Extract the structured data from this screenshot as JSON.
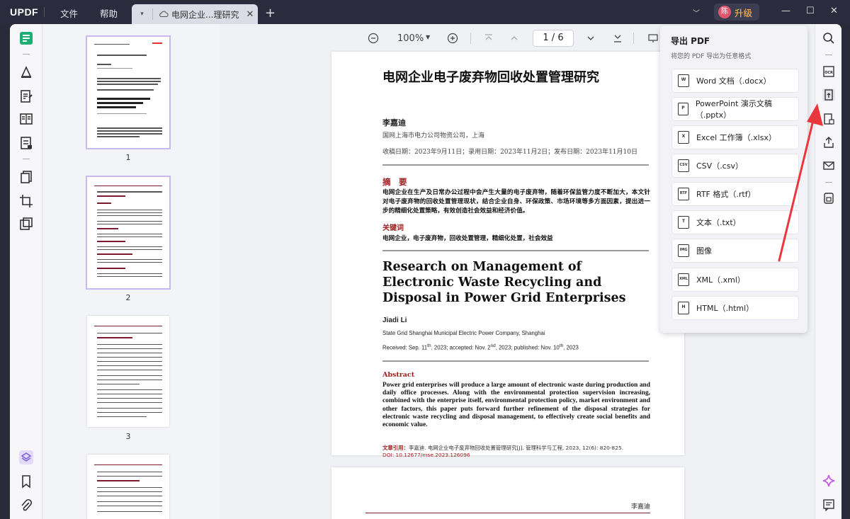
{
  "titlebar": {
    "logo": "UPDF",
    "menu_file": "文件",
    "menu_help": "帮助",
    "tab_title": "电网企业...理研究",
    "tab_close": "✕",
    "new_tab": "+",
    "upgrade_avatar": "陈",
    "upgrade_label": "升级"
  },
  "viewer": {
    "zoom": "100%",
    "page_current": "1",
    "page_total": "6",
    "page_display": "1 / 6"
  },
  "thumbnails": [
    {
      "label": "1"
    },
    {
      "label": "2"
    },
    {
      "label": "3"
    }
  ],
  "document": {
    "title": "电网企业电子废弃物回收处置管理研究",
    "author": "李嘉迪",
    "affiliation": "国网上海市电力公司物资公司，上海",
    "dates": "收稿日期：2023年9月11日；录用日期：2023年11月2日；发布日期：2023年11月10日",
    "abstract_heading": "摘　要",
    "abstract": "电网企业在生产及日常办公过程中会产生大量的电子废弃物，随着环保监管力度不断加大，本文针对电子废弃物的回收处置管理现状，结合企业自身、环保政策、市场环境等多方面因素，提出进一步的精细化处置策略，有效创造社会效益和经济价值。",
    "keywords_heading": "关键词",
    "keywords": "电网企业，电子废弃物，回收处置管理，精细化处置，社会效益",
    "en_title": "Research on Management of Electronic Waste Recycling and Disposal in Power Grid Enterprises",
    "en_author": "Jiadi Li",
    "en_affiliation": "State Grid Shanghai Municipal Electric Power Company, Shanghai",
    "en_dates_a": "Received: Sep. 11",
    "en_dates_b": ", 2023; accepted: Nov. 2",
    "en_dates_c": ", 2023; published: Nov. 10",
    "en_dates_d": ", 2023",
    "sup_th": "th",
    "sup_nd": "nd",
    "en_abstract_heading": "Abstract",
    "en_abstract": "Power grid enterprises will produce a large amount of electronic waste during production and daily office processes. Along with the environmental protection supervision increasing, combined with the enterprise itself, environmental protection policy, market environment and other factors, this paper puts forward further refinement of the disposal strategies for electronic waste recycling and disposal management, to effectively create social benefits and economic value.",
    "cite_label": "文章引用：",
    "cite": "李嘉迪. 电网企业电子废弃物回收处置管理研究[J]. 管理科学与工程, 2023, 12(6): 820-825.",
    "doi": "DOI: 10.12677/mse.2023.126096",
    "page2_header": "李嘉迪"
  },
  "export_panel": {
    "title": "导出 PDF",
    "subtitle": "将您的 PDF 导出为任意格式",
    "items": [
      {
        "label": "Word 文档（.docx）",
        "icon": "W"
      },
      {
        "label": "PowerPoint 演示文稿（.pptx）",
        "icon": "P"
      },
      {
        "label": "Excel 工作簿（.xlsx）",
        "icon": "X"
      },
      {
        "label": "CSV（.csv）",
        "icon": "CSV"
      },
      {
        "label": "RTF 格式（.rtf）",
        "icon": "RTF"
      },
      {
        "label": "文本（.txt）",
        "icon": "T"
      },
      {
        "label": "图像",
        "icon": "IMG"
      },
      {
        "label": "XML（.xml）",
        "icon": "XML"
      },
      {
        "label": "HTML（.html）",
        "icon": "H"
      }
    ]
  },
  "colors": {
    "titlebar": "#2b2b3d",
    "accent_red": "#9b1c1c",
    "arrow_red": "#e8383d",
    "panel_bg": "#f3f3f7"
  }
}
